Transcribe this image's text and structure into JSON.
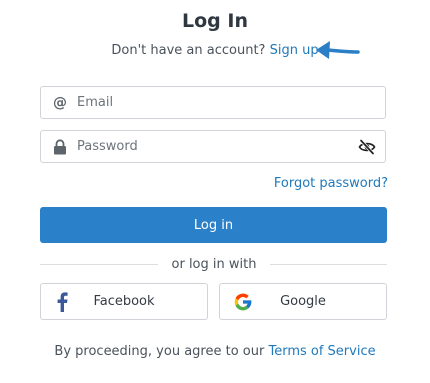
{
  "header": {
    "title": "Log In",
    "signup_prompt": "Don't have an account?",
    "signup_link": "Sign up"
  },
  "form": {
    "email": {
      "placeholder": "Email",
      "value": ""
    },
    "password": {
      "placeholder": "Password",
      "value": ""
    },
    "forgot_link": "Forgot password?",
    "login_button": "Log in"
  },
  "social": {
    "divider_text": "or log in with",
    "facebook_label": "Facebook",
    "google_label": "Google"
  },
  "footer": {
    "terms_prefix": "By proceeding, you agree to our",
    "terms_link": "Terms of Service"
  },
  "icons": {
    "email": "at-icon",
    "password": "lock-icon",
    "visibility": "eye-off-icon",
    "facebook": "facebook-icon",
    "google": "google-icon",
    "annotation": "arrow-icon"
  },
  "colors": {
    "accent": "#2b81c9",
    "link": "#1f79bb",
    "annotation_arrow": "#2a7fc6",
    "border": "#d0d4d8"
  }
}
